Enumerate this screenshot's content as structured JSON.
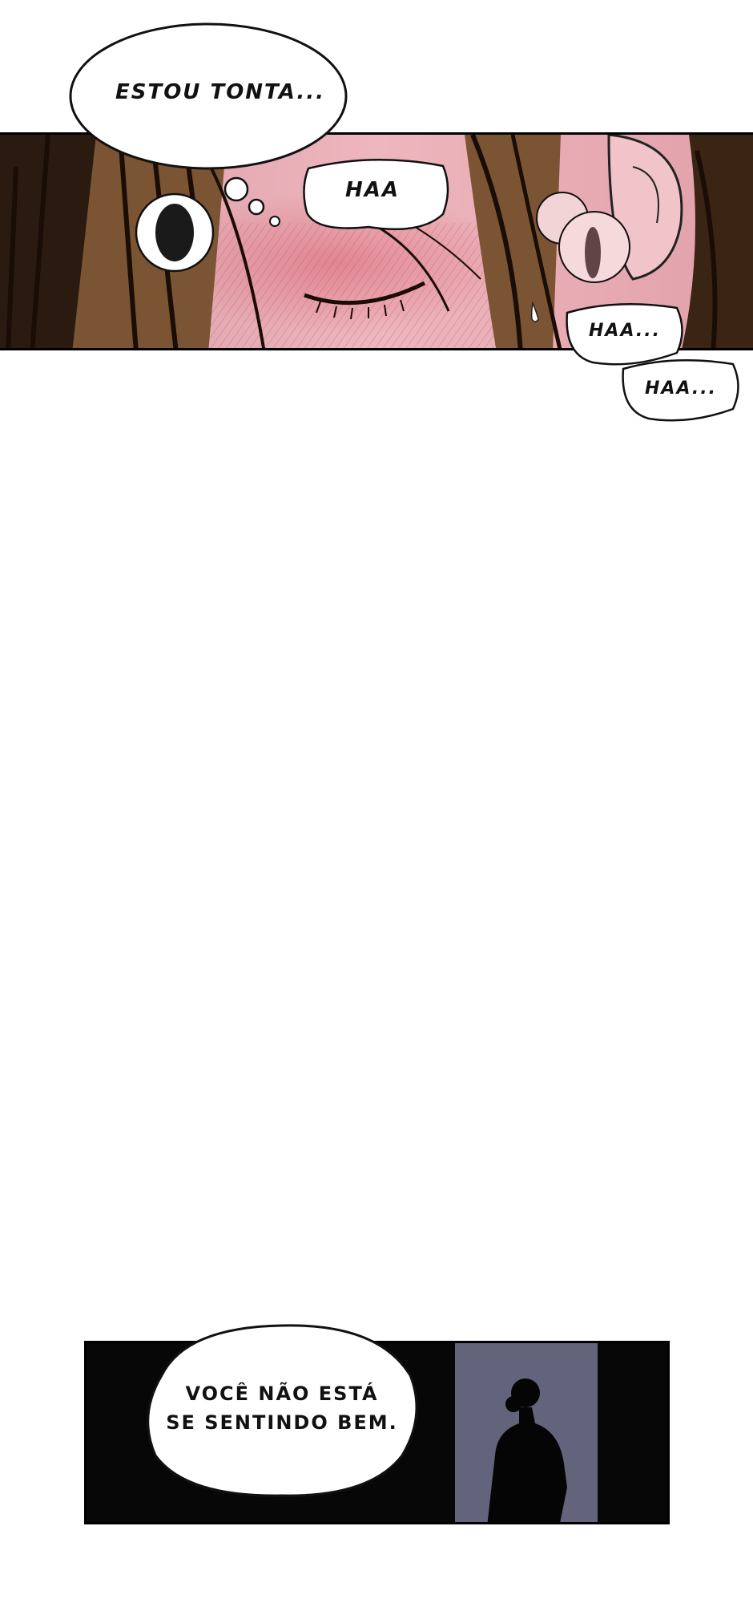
{
  "panel_top": {
    "thought_bubble": "ESTOU TONTA...",
    "breath_1": "HAA",
    "breath_2": "HAA...",
    "breath_3": "HAA..."
  },
  "panel_bottom": {
    "speech_line_1": "VOCÊ NÃO ESTÁ",
    "speech_line_2": "SE SENTINDO BEM."
  },
  "colors": {
    "skin": "#e8a7b0",
    "hair": "#7a5433",
    "door_light": "#5c5e76",
    "background": "#070707"
  }
}
